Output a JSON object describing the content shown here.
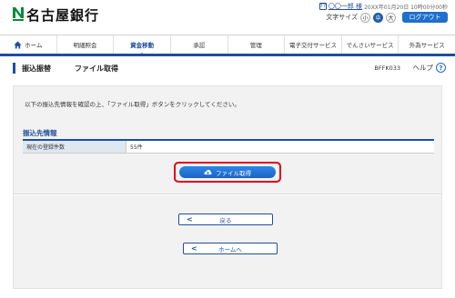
{
  "header": {
    "bank_name": "名古屋銀行",
    "user_icon": "77",
    "user_name": "〇〇一郎 様",
    "last_login": "20XX年01月20日 10時00分00秒",
    "font_size_label": "文字サイズ",
    "font_sizes": [
      "小",
      "中",
      "大"
    ],
    "logout_label": "ログアウト"
  },
  "nav": {
    "items": [
      "ホーム",
      "明細照会",
      "資金移動",
      "承認",
      "管理",
      "電子交付サービス",
      "でんさいサービス",
      "外為サービス"
    ],
    "active_index": 2
  },
  "page": {
    "title": "振込振替",
    "subtitle": "ファイル取得",
    "screen_id": "BFFK033",
    "help_label": "ヘルプ",
    "help_icon": "?"
  },
  "content": {
    "instruction": "以下の振込先情報を確認の上、「ファイル取得」ボタンをクリックしてください。",
    "section_title": "振込先情報",
    "registered_count_label": "現在の登録件数",
    "registered_count_value": "55件",
    "file_button_label": "ファイル取得",
    "back_button_label": "戻る",
    "home_button_label": "ホームへ"
  },
  "colors": {
    "brand": "#1f4e9a",
    "accent": "#1f6fcc",
    "highlight": "#e0001b"
  }
}
